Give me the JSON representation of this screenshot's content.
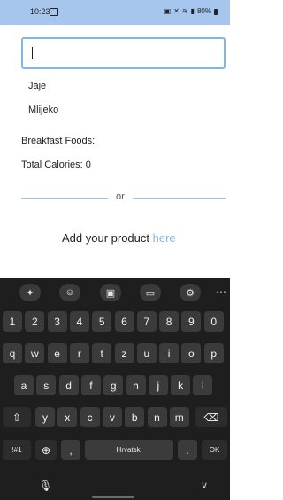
{
  "status_bar": {
    "time": "10:23",
    "battery": "80%",
    "icons": [
      "photo-icon",
      "lock-icon",
      "mute-icon",
      "wifi-icon",
      "signal-icon",
      "battery-icon"
    ]
  },
  "search": {
    "value": "",
    "placeholder": ""
  },
  "suggestions": [
    "Jaje",
    "Mlijeko"
  ],
  "breakfast_label": "Breakfast Foods:",
  "total_calories": "Total Calories: 0",
  "divider_text": "or",
  "add_product": {
    "prefix": "Add your product ",
    "link": "here"
  },
  "keyboard": {
    "tools": [
      "sparkle-icon",
      "emoji-icon",
      "sticker-icon",
      "clipboard-icon",
      "settings-icon"
    ],
    "more": "⋯",
    "number_row": [
      "1",
      "2",
      "3",
      "4",
      "5",
      "6",
      "7",
      "8",
      "9",
      "0"
    ],
    "row1": [
      "q",
      "w",
      "e",
      "r",
      "t",
      "z",
      "u",
      "i",
      "o",
      "p"
    ],
    "row2": [
      "a",
      "s",
      "d",
      "f",
      "g",
      "h",
      "j",
      "k",
      "l"
    ],
    "row3": [
      "y",
      "x",
      "c",
      "v",
      "b",
      "n",
      "m"
    ],
    "symbols_label": "!#1",
    "comma": ",",
    "space_label": "Hrvatski",
    "period": ".",
    "ok_label": "OK"
  },
  "colors": {
    "status_bar": "#a6c6ee",
    "input_border": "#7fb6e8",
    "link": "#89b8dc",
    "divider": "#9cc3ea",
    "keyboard_bg": "#1e1e1e",
    "key_bg": "#3b3b3b"
  }
}
